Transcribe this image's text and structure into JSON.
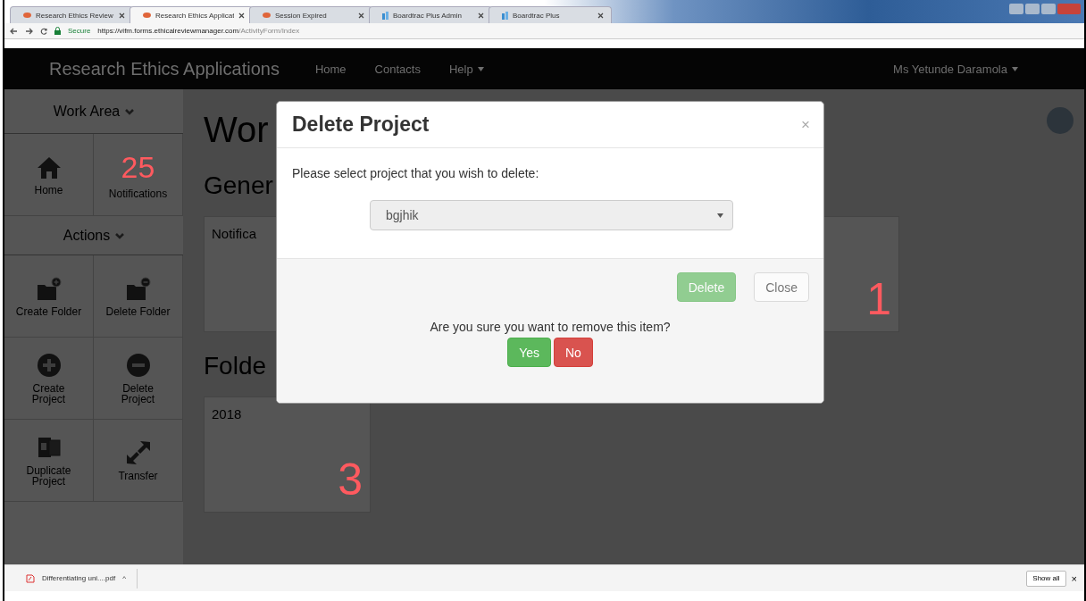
{
  "browser": {
    "tabs": [
      {
        "title": "Research Ethics Review",
        "kind": "ethics",
        "selected": false
      },
      {
        "title": "Research Ethics Applicat",
        "kind": "ethics",
        "selected": true
      },
      {
        "title": "Session Expired",
        "kind": "ethics",
        "selected": false
      },
      {
        "title": "Boardtrac Plus Admin",
        "kind": "boardtrac",
        "selected": false
      },
      {
        "title": "Boardtrac Plus",
        "kind": "boardtrac",
        "selected": false
      }
    ],
    "secure_label": "Secure",
    "url_host": "https://vifm.forms.ethicalreviewmanager.com",
    "url_path": "/ActivityForm/Index"
  },
  "navbar": {
    "brand": "Research Ethics Applications",
    "links": [
      {
        "label": "Home",
        "dropdown": false
      },
      {
        "label": "Contacts",
        "dropdown": false
      },
      {
        "label": "Help",
        "dropdown": true
      }
    ],
    "user": "Ms Yetunde Daramola"
  },
  "sidebar": {
    "sections": [
      {
        "title": "Work Area",
        "tiles": [
          {
            "kind": "home",
            "label": "Home"
          },
          {
            "kind": "count",
            "count": "25",
            "label": "Notifications"
          }
        ]
      },
      {
        "title": "Actions",
        "tiles": [
          {
            "kind": "folder-add",
            "label": "Create Folder"
          },
          {
            "kind": "folder-remove",
            "label": "Delete Folder"
          },
          {
            "kind": "plus",
            "label": "Create Project"
          },
          {
            "kind": "minus",
            "label": "Delete Project"
          },
          {
            "kind": "duplicate",
            "label": "Duplicate Project"
          },
          {
            "kind": "transfer",
            "label": "Transfer"
          }
        ]
      }
    ]
  },
  "main": {
    "title": "Wor",
    "sections": [
      {
        "heading": "Gener",
        "cards": [
          {
            "label": "Notifica"
          },
          {
            "count": "1"
          }
        ]
      },
      {
        "heading": "Folde",
        "cards": [
          {
            "label": "2018",
            "count": "3"
          }
        ]
      }
    ]
  },
  "modal": {
    "title": "Delete Project",
    "close": "×",
    "prompt": "Please select project that you wish to delete:",
    "select_value": "bgjhik",
    "buttons": [
      {
        "label": "Delete",
        "kind": "success",
        "disabled": true
      },
      {
        "label": "Close",
        "kind": "default",
        "disabled": true
      }
    ],
    "confirm": {
      "text": "Are you sure you want to remove this item?",
      "buttons": [
        {
          "label": "Yes",
          "kind": "success"
        },
        {
          "label": "No",
          "kind": "danger"
        }
      ]
    }
  },
  "downloads": {
    "file": "Differentiating uni....pdf",
    "caret": "^",
    "show_all": "Show all",
    "close": "×"
  }
}
